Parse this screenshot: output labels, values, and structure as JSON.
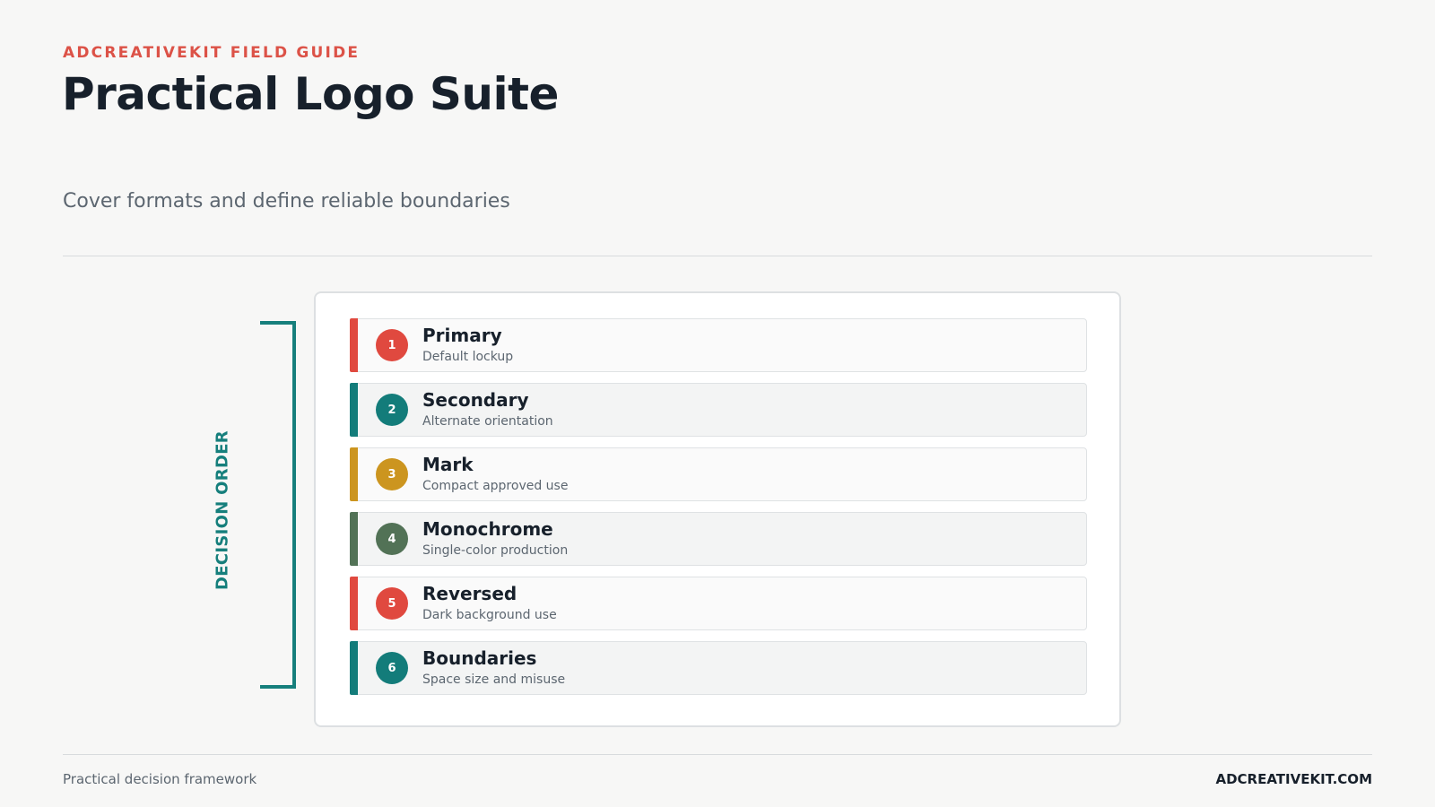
{
  "header": {
    "eyebrow": "ADCREATIVEKIT FIELD GUIDE",
    "title": "Practical Logo Suite",
    "subtitle": "Cover formats and define reliable boundaries"
  },
  "sidebar_label": "DECISION ORDER",
  "items": [
    {
      "number": "1",
      "name": "Primary",
      "desc": "Default lockup",
      "color": "#e0493f"
    },
    {
      "number": "2",
      "name": "Secondary",
      "desc": "Alternate orientation",
      "color": "#137c7a"
    },
    {
      "number": "3",
      "name": "Mark",
      "desc": "Compact approved use",
      "color": "#cc951f"
    },
    {
      "number": "4",
      "name": "Monochrome",
      "desc": "Single-color production",
      "color": "#527256"
    },
    {
      "number": "5",
      "name": "Reversed",
      "desc": "Dark background use",
      "color": "#e0493f"
    },
    {
      "number": "6",
      "name": "Boundaries",
      "desc": "Space size and misuse",
      "color": "#137c7a"
    }
  ],
  "footer": {
    "left": "Practical decision framework",
    "right": "ADCREATIVEKIT.COM"
  }
}
